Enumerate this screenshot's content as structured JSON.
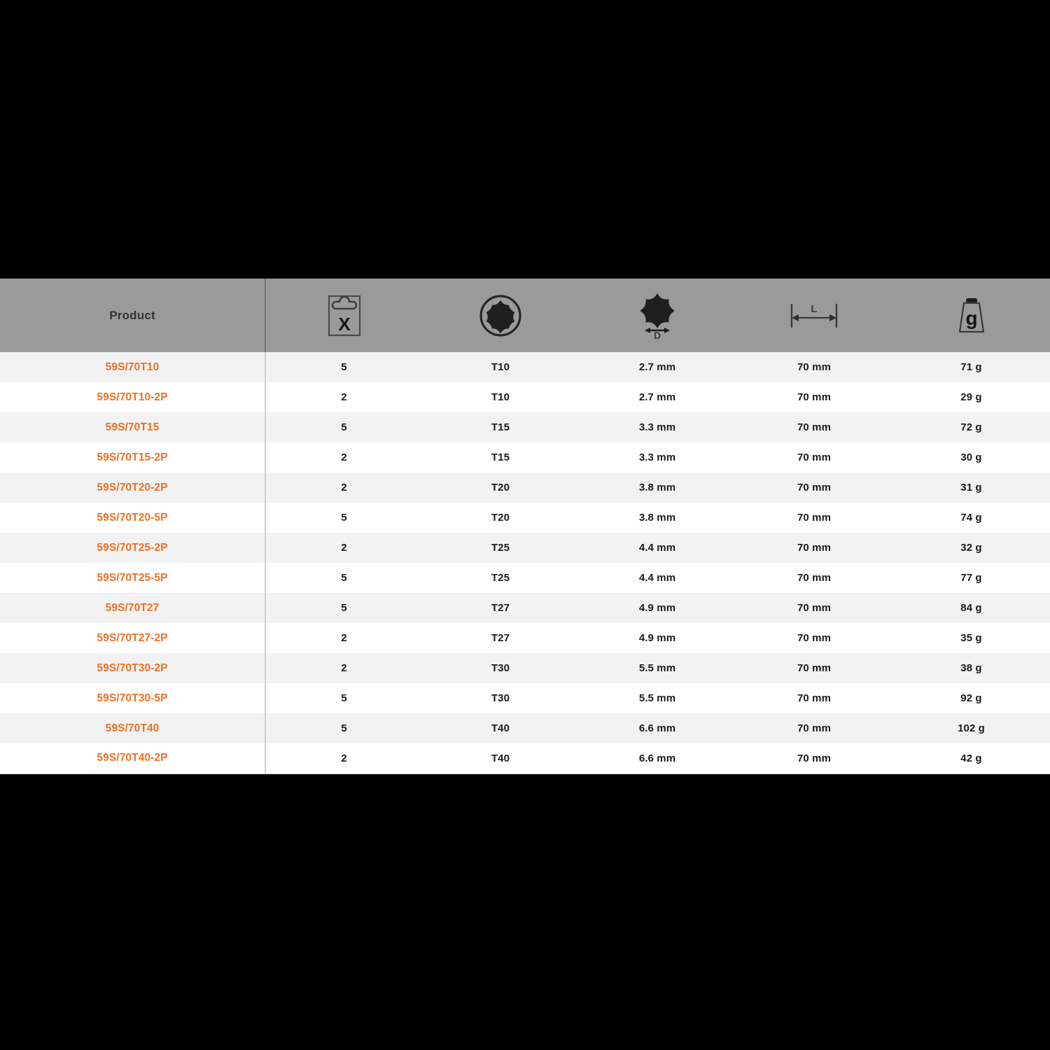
{
  "theme": {
    "accent_orange": "#ee7023",
    "header_gray": "#9a9a9a",
    "row_stripe": "#f2f2f2",
    "row_plain": "#ffffff",
    "text_dark": "#1a1a1a",
    "backdrop": "#000000"
  },
  "table": {
    "columns": [
      {
        "key": "product",
        "label": "Product",
        "icon": null,
        "type": "text"
      },
      {
        "key": "quantity",
        "label": "",
        "icon": "package-quantity-icon",
        "icon_letter": "X",
        "type": "number"
      },
      {
        "key": "torx",
        "label": "",
        "icon": "torx-drive-icon",
        "type": "text"
      },
      {
        "key": "diameter",
        "label": "",
        "icon": "torx-diameter-icon",
        "icon_letter": "D",
        "type": "dimension"
      },
      {
        "key": "length",
        "label": "",
        "icon": "length-dimension-icon",
        "icon_letter": "L",
        "type": "dimension"
      },
      {
        "key": "weight",
        "label": "",
        "icon": "weight-icon",
        "icon_letter": "g",
        "type": "mass"
      }
    ],
    "rows": [
      {
        "product": "59S/70T10",
        "quantity": "5",
        "torx": "T10",
        "diameter": "2.7 mm",
        "length": "70 mm",
        "weight": "71 g"
      },
      {
        "product": "59S/70T10-2P",
        "quantity": "2",
        "torx": "T10",
        "diameter": "2.7 mm",
        "length": "70 mm",
        "weight": "29 g"
      },
      {
        "product": "59S/70T15",
        "quantity": "5",
        "torx": "T15",
        "diameter": "3.3 mm",
        "length": "70 mm",
        "weight": "72 g"
      },
      {
        "product": "59S/70T15-2P",
        "quantity": "2",
        "torx": "T15",
        "diameter": "3.3 mm",
        "length": "70 mm",
        "weight": "30 g"
      },
      {
        "product": "59S/70T20-2P",
        "quantity": "2",
        "torx": "T20",
        "diameter": "3.8 mm",
        "length": "70 mm",
        "weight": "31 g"
      },
      {
        "product": "59S/70T20-5P",
        "quantity": "5",
        "torx": "T20",
        "diameter": "3.8 mm",
        "length": "70 mm",
        "weight": "74 g"
      },
      {
        "product": "59S/70T25-2P",
        "quantity": "2",
        "torx": "T25",
        "diameter": "4.4 mm",
        "length": "70 mm",
        "weight": "32 g"
      },
      {
        "product": "59S/70T25-5P",
        "quantity": "5",
        "torx": "T25",
        "diameter": "4.4 mm",
        "length": "70 mm",
        "weight": "77 g"
      },
      {
        "product": "59S/70T27",
        "quantity": "5",
        "torx": "T27",
        "diameter": "4.9 mm",
        "length": "70 mm",
        "weight": "84 g"
      },
      {
        "product": "59S/70T27-2P",
        "quantity": "2",
        "torx": "T27",
        "diameter": "4.9 mm",
        "length": "70 mm",
        "weight": "35 g"
      },
      {
        "product": "59S/70T30-2P",
        "quantity": "2",
        "torx": "T30",
        "diameter": "5.5 mm",
        "length": "70 mm",
        "weight": "38 g"
      },
      {
        "product": "59S/70T30-5P",
        "quantity": "5",
        "torx": "T30",
        "diameter": "5.5 mm",
        "length": "70 mm",
        "weight": "92 g"
      },
      {
        "product": "59S/70T40",
        "quantity": "5",
        "torx": "T40",
        "diameter": "6.6 mm",
        "length": "70 mm",
        "weight": "102 g"
      },
      {
        "product": "59S/70T40-2P",
        "quantity": "2",
        "torx": "T40",
        "diameter": "6.6 mm",
        "length": "70 mm",
        "weight": "42 g"
      }
    ]
  }
}
